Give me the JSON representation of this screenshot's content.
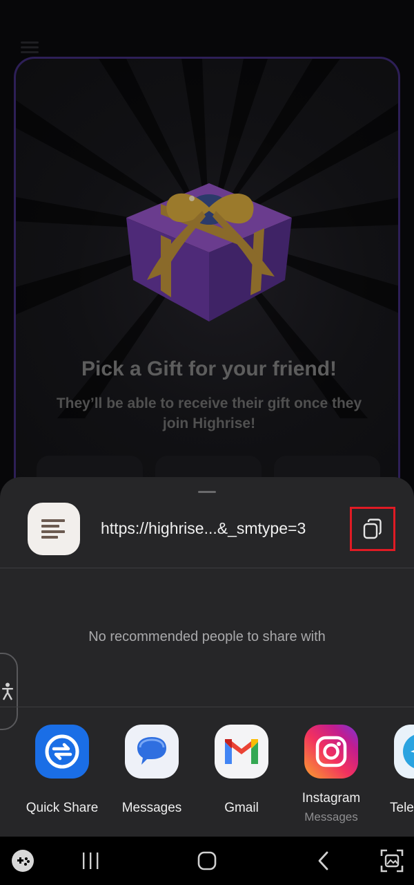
{
  "background": {
    "title": "Pick a Gift for your friend!",
    "subtitle": "They’ll be able to receive their gift once they join Highrise!",
    "icons": [
      "menu-icon",
      "gift-box-image"
    ]
  },
  "share_sheet": {
    "link": {
      "url": "https://highrise...&_smtype=3",
      "thumbnail_icon": "document-icon",
      "copy_icon": "copy-icon"
    },
    "empty_message": "No recommended people to share with",
    "accessibility_icon": "accessibility-icon",
    "apps": [
      {
        "label": "Quick Share",
        "sublabel": "",
        "icon": "quick-share-icon"
      },
      {
        "label": "Messages",
        "sublabel": "",
        "icon": "messages-icon"
      },
      {
        "label": "Gmail",
        "sublabel": "",
        "icon": "gmail-icon"
      },
      {
        "label": "Instagram",
        "sublabel": "Messages",
        "icon": "instagram-icon"
      },
      {
        "label": "Tele",
        "sublabel": "",
        "icon": "telegram-icon"
      }
    ]
  },
  "navbar": {
    "icons": [
      "game-launcher-icon",
      "recent-apps-icon",
      "home-icon",
      "back-icon",
      "screenshot-icon"
    ]
  },
  "colors": {
    "sheet_background": "#262628",
    "highlight": "#e01b24",
    "card_border": "#2d1f57"
  }
}
